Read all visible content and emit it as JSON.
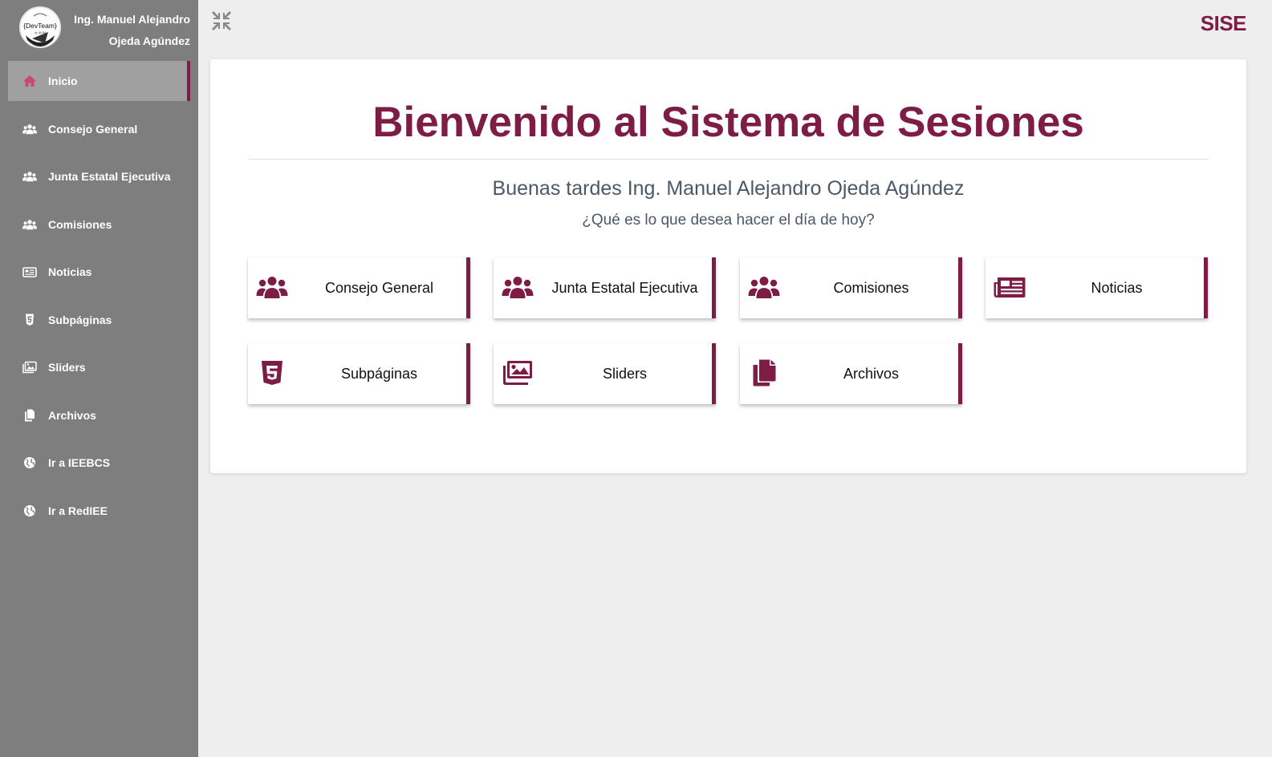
{
  "user": {
    "name": "Ing. Manuel Alejandro Ojeda Agúndez",
    "avatar_icon": "devteam-logo",
    "avatar_text": "{DevTeam}"
  },
  "brand": "SISE",
  "colors": {
    "accent": "#7d1d45",
    "sidebar_bg": "#7e7e7e",
    "sidebar_active_bg": "#a0a0a0",
    "page_bg": "#eeeeee",
    "text_secondary": "#4d5866"
  },
  "sidebar": {
    "items": [
      {
        "label": "Inicio",
        "icon": "home-icon",
        "active": true
      },
      {
        "label": "Consejo General",
        "icon": "users-icon"
      },
      {
        "label": "Junta Estatal Ejecutiva",
        "icon": "users-icon"
      },
      {
        "label": "Comisiones",
        "icon": "users-icon"
      },
      {
        "label": "Noticias",
        "icon": "newspaper-icon"
      },
      {
        "label": "Subpáginas",
        "icon": "html5-icon"
      },
      {
        "label": "Sliders",
        "icon": "images-icon"
      },
      {
        "label": "Archivos",
        "icon": "copy-icon"
      },
      {
        "label": "Ir a IEEBCS",
        "icon": "globe-icon"
      },
      {
        "label": "Ir a RedIEE",
        "icon": "globe-icon"
      }
    ]
  },
  "toolbar": {
    "collapse_icon": "compress-icon"
  },
  "main": {
    "title": "Bienvenido al Sistema de Sesiones",
    "greeting": "Buenas tardes Ing. Manuel Alejandro Ojeda Agúndez",
    "question": "¿Qué es lo que desea hacer el día de hoy?",
    "tiles": [
      {
        "label": "Consejo General",
        "icon": "users-icon"
      },
      {
        "label": "Junta Estatal Ejecutiva",
        "icon": "users-icon"
      },
      {
        "label": "Comisiones",
        "icon": "users-icon"
      },
      {
        "label": "Noticias",
        "icon": "newspaper-icon"
      },
      {
        "label": "Subpáginas",
        "icon": "html5-icon"
      },
      {
        "label": "Sliders",
        "icon": "images-icon"
      },
      {
        "label": "Archivos",
        "icon": "copy-icon"
      }
    ]
  }
}
